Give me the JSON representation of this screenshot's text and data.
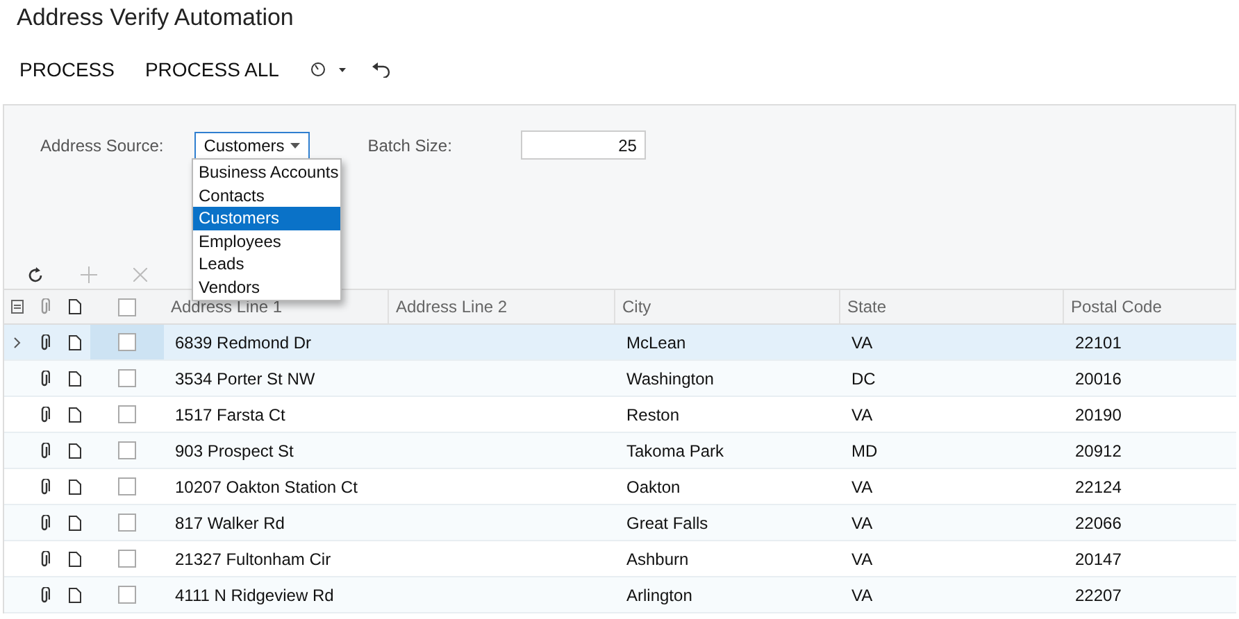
{
  "title": "Address Verify Automation",
  "toolbar": [
    "PROCESS",
    "PROCESS ALL"
  ],
  "form": {
    "source_label": "Address Source:",
    "source_value": "Customers",
    "batch_label": "Batch Size:",
    "batch_value": "25",
    "options": [
      {
        "label": "Business Accounts",
        "selected": false
      },
      {
        "label": "Contacts",
        "selected": false
      },
      {
        "label": "Customers",
        "selected": true
      },
      {
        "label": "Employees",
        "selected": false
      },
      {
        "label": "Leads",
        "selected": false
      },
      {
        "label": "Vendors",
        "selected": false
      }
    ]
  },
  "table": {
    "select_all": {
      "checked": false
    },
    "columns": [
      "Address Line 1",
      "Address Line 2",
      "City",
      "State",
      "Postal Code"
    ],
    "rows": [
      {
        "selected": true,
        "checked": false,
        "cells": [
          "6839 Redmond Dr",
          "",
          "McLean",
          "VA",
          "22101"
        ]
      },
      {
        "selected": false,
        "checked": false,
        "cells": [
          "3534 Porter St NW",
          "",
          "Washington",
          "DC",
          "20016"
        ]
      },
      {
        "selected": false,
        "checked": false,
        "cells": [
          "1517 Farsta Ct",
          "",
          "Reston",
          "VA",
          "20190"
        ]
      },
      {
        "selected": false,
        "checked": false,
        "cells": [
          "903 Prospect St",
          "",
          "Takoma Park",
          "MD",
          "20912"
        ]
      },
      {
        "selected": false,
        "checked": false,
        "cells": [
          "10207 Oakton Station Ct",
          "",
          "Oakton",
          "VA",
          "22124"
        ]
      },
      {
        "selected": false,
        "checked": false,
        "cells": [
          "817 Walker Rd",
          "",
          "Great Falls",
          "VA",
          "22066"
        ]
      },
      {
        "selected": false,
        "checked": false,
        "cells": [
          "21327 Fultonham Cir",
          "",
          "Ashburn",
          "VA",
          "20147"
        ]
      },
      {
        "selected": false,
        "checked": false,
        "cells": [
          "4111 N Ridgeview Rd",
          "",
          "Arlington",
          "VA",
          "22207"
        ]
      }
    ]
  }
}
